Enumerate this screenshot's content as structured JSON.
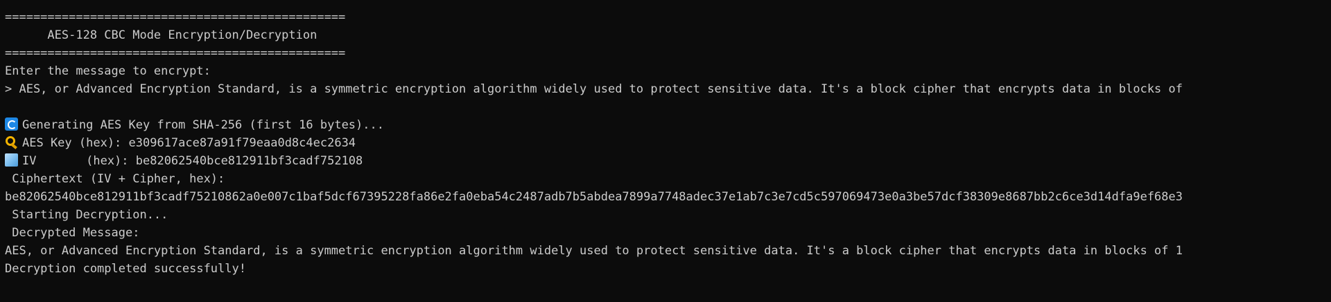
{
  "terminal": {
    "banner_top": "================================================",
    "banner_title": "      AES-128 CBC Mode Encryption/Decryption",
    "banner_bottom": "================================================",
    "prompt_label": "Enter the message to encrypt:",
    "input_line": "> AES, or Advanced Encryption Standard, is a symmetric encryption algorithm widely used to protect sensitive data. It's a block cipher that encrypts data in blocks of",
    "generating_text": "Generating AES Key from SHA-256 (first 16 bytes)...",
    "key_text": "AES Key (hex): e309617ace87a91f79eaa0d8c4ec2634",
    "iv_text": "IV       (hex): be82062540bce812911bf3cadf752108",
    "ciphertext_label": " Ciphertext (IV + Cipher, hex):",
    "ciphertext_value": "be82062540bce812911bf3cadf75210862a0e007c1baf5dcf67395228fa86e2fa0eba54c2487adb7b5abdea7899a7748adec37e1ab7c3e7cd5c597069473e0a3be57dcf38309e8687bb2c6ce3d14dfa9ef68e3",
    "starting_decryption": " Starting Decryption...",
    "decrypted_label": " Decrypted Message:",
    "decrypted_value": "AES, or Advanced Encryption Standard, is a symmetric encryption algorithm widely used to protect sensitive data. It's a block cipher that encrypts data in blocks of 1",
    "completed_text": "Decryption completed successfully!"
  },
  "icons": {
    "generating": "refresh-icon",
    "key": "key-icon",
    "iv": "ice-cube-icon"
  },
  "colors": {
    "background": "#0c0c0c",
    "foreground": "#cccccc"
  }
}
